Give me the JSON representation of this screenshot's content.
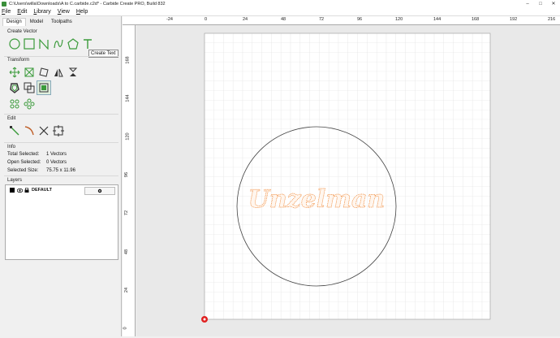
{
  "window": {
    "title": "C:\\Users\\willa\\Downloads\\A to C.carbide.c2d* - Carbide Create PRO, Build 832"
  },
  "menu": [
    "File",
    "Edit",
    "Library",
    "View",
    "Help"
  ],
  "tabs": [
    {
      "label": "Design",
      "active": true
    },
    {
      "label": "Model",
      "active": false
    },
    {
      "label": "Toolpaths",
      "active": false
    }
  ],
  "sections": {
    "create_vector": "Create Vector",
    "transform": "Transform",
    "edit": "Edit",
    "info": "Info",
    "layers": "Layers"
  },
  "tooltip": "Create Text",
  "info": {
    "total_selected_label": "Total Selected:",
    "total_selected_value": "1 Vectors",
    "open_selected_label": "Open Selected:",
    "open_selected_value": "0 Vectors",
    "selected_size_label": "Selected Size:",
    "selected_size_value": "75.75 x 11.96"
  },
  "layers": [
    {
      "name": "DEFAULT",
      "color": "#000000"
    }
  ],
  "ruler_top_labels": [
    "-24",
    "0",
    "24",
    "48",
    "72",
    "96",
    "120",
    "144",
    "168",
    "192",
    "216"
  ],
  "ruler_left_labels": [
    "168",
    "144",
    "120",
    "96",
    "72",
    "48",
    "24",
    "0"
  ],
  "design_text": "Unzelman",
  "colors": {
    "accent_green": "#3a9a3a",
    "text_outline": "#f08a3a",
    "grid": "#dcdcdc",
    "origin": "#e02020"
  },
  "icons": {
    "create_vector": [
      "circle-icon",
      "rectangle-icon",
      "polyline-icon",
      "curve-icon",
      "polygon-icon",
      "text-icon"
    ],
    "transform": [
      "move-icon",
      "scale-icon",
      "rotate-icon",
      "mirror-icon",
      "flip-icon",
      "offset-icon",
      "boolean-icon",
      "align-icon",
      "array-icon",
      "pattern-icon"
    ],
    "edit": [
      "node-edit-icon",
      "curve-edit-icon",
      "trim-icon",
      "fit-icon"
    ]
  }
}
